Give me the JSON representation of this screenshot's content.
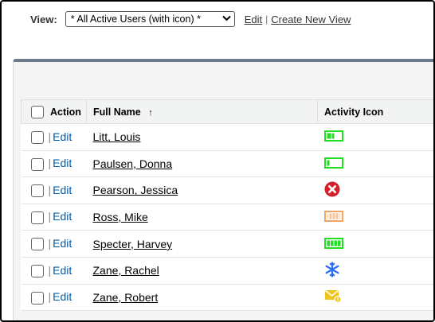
{
  "view_bar": {
    "label": "View:",
    "selected": "* All Active Users (with icon) *",
    "edit_link": "Edit",
    "separator": "|",
    "create_link": "Create New View"
  },
  "table": {
    "headers": {
      "action": "Action",
      "full_name": "Full Name",
      "sort_indicator": "↑",
      "activity_icon": "Activity Icon"
    },
    "rows": [
      {
        "separator": "|",
        "edit": "Edit",
        "name": "Litt, Louis",
        "icon": "battery-high-icon"
      },
      {
        "separator": "|",
        "edit": "Edit",
        "name": "Paulsen, Donna",
        "icon": "battery-low-icon"
      },
      {
        "separator": "|",
        "edit": "Edit",
        "name": "Pearson, Jessica",
        "icon": "error-x-icon"
      },
      {
        "separator": "|",
        "edit": "Edit",
        "name": "Ross, Mike",
        "icon": "battery-empty-orange-icon"
      },
      {
        "separator": "|",
        "edit": "Edit",
        "name": "Specter, Harvey",
        "icon": "battery-full-icon"
      },
      {
        "separator": "|",
        "edit": "Edit",
        "name": "Zane, Rachel",
        "icon": "snowflake-icon"
      },
      {
        "separator": "|",
        "edit": "Edit",
        "name": "Zane, Robert",
        "icon": "envelope-alert-icon"
      }
    ]
  },
  "colors": {
    "link_blue": "#015ba7",
    "battery_green": "#22dd22",
    "error_red": "#d4202a",
    "battery_orange": "#f4a460",
    "snow_blue": "#2a6ef2",
    "mail_yellow": "#f0c419",
    "panel_border": "#6b7b8c"
  }
}
